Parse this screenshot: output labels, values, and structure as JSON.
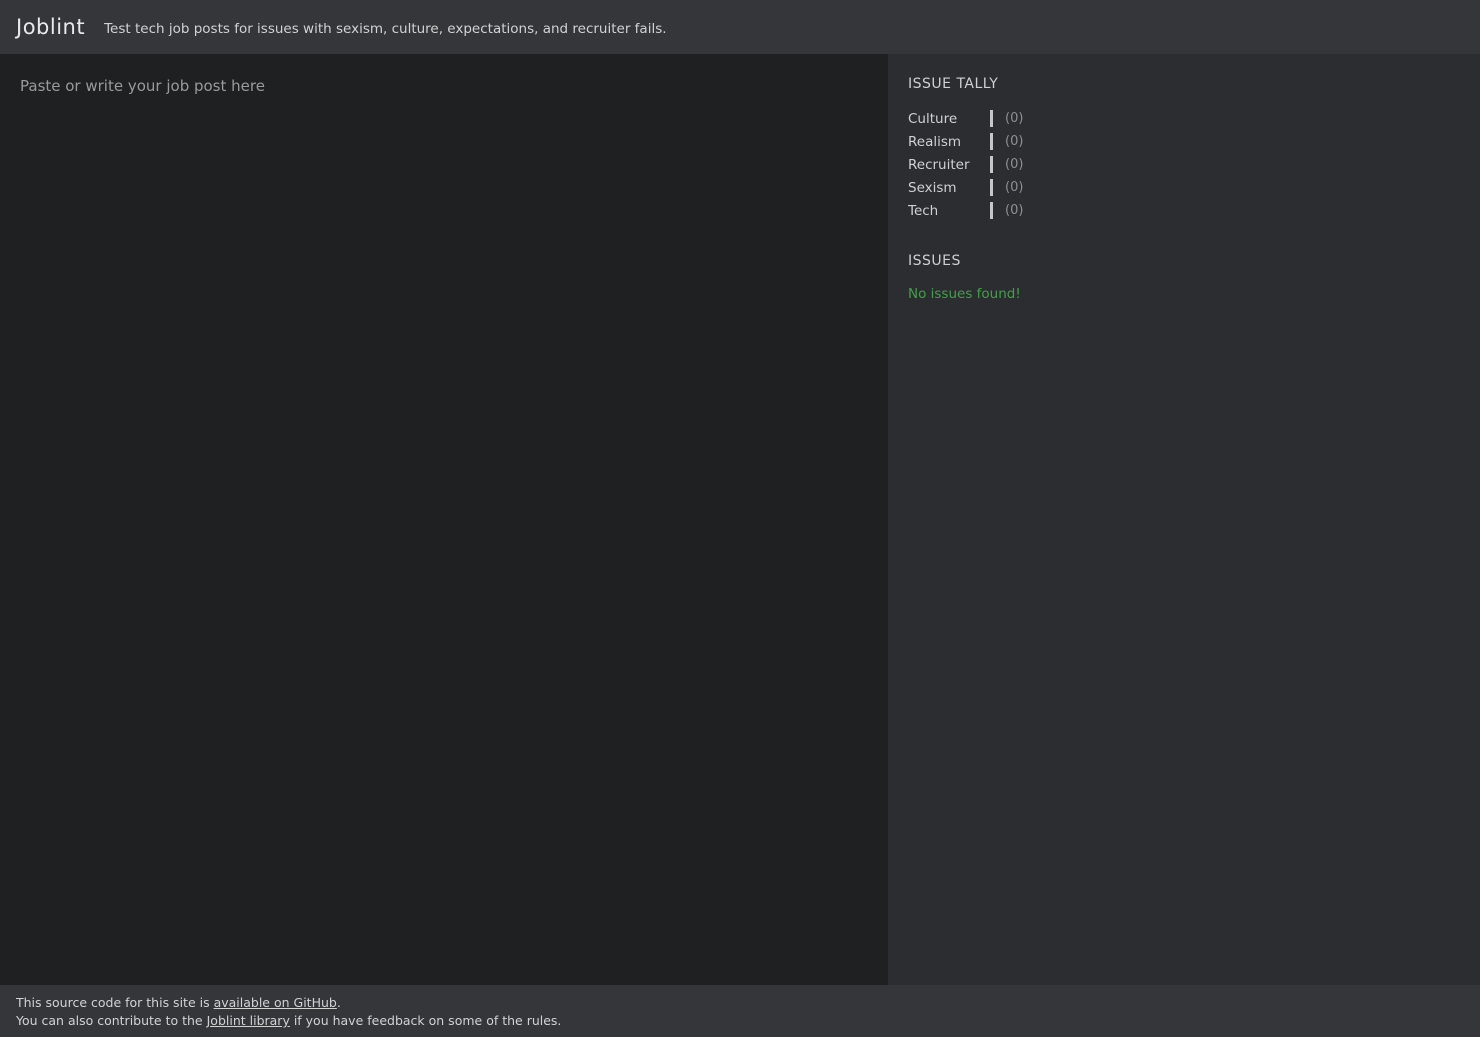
{
  "header": {
    "title": "Joblint",
    "subtitle": "Test tech job posts for issues with sexism, culture, expectations, and recruiter fails."
  },
  "editor": {
    "placeholder": "Paste or write your job post here",
    "value": ""
  },
  "sidebar": {
    "tally_heading": "ISSUE TALLY",
    "tally": [
      {
        "label": "Culture",
        "count": "(0)"
      },
      {
        "label": "Realism",
        "count": "(0)"
      },
      {
        "label": "Recruiter",
        "count": "(0)"
      },
      {
        "label": "Sexism",
        "count": "(0)"
      },
      {
        "label": "Tech",
        "count": "(0)"
      }
    ],
    "issues_heading": "ISSUES",
    "issues_empty_message": "No issues found!"
  },
  "footer": {
    "line1_prefix": "This source code for this site is ",
    "line1_link": "available on GitHub",
    "line1_suffix": ".",
    "line2_prefix": "You can also contribute to the ",
    "line2_link": "Joblint library",
    "line2_suffix": " if you have feedback on some of the rules."
  },
  "colors": {
    "header_bg": "#35363a",
    "main_bg": "#1f2022",
    "sidebar_bg": "#2b2d31",
    "footer_bg": "#35363a",
    "text": "#d6d6d6",
    "muted_text": "#8f8f8f",
    "success_green": "#43a047",
    "tally_bar": "#c6c6c6"
  }
}
